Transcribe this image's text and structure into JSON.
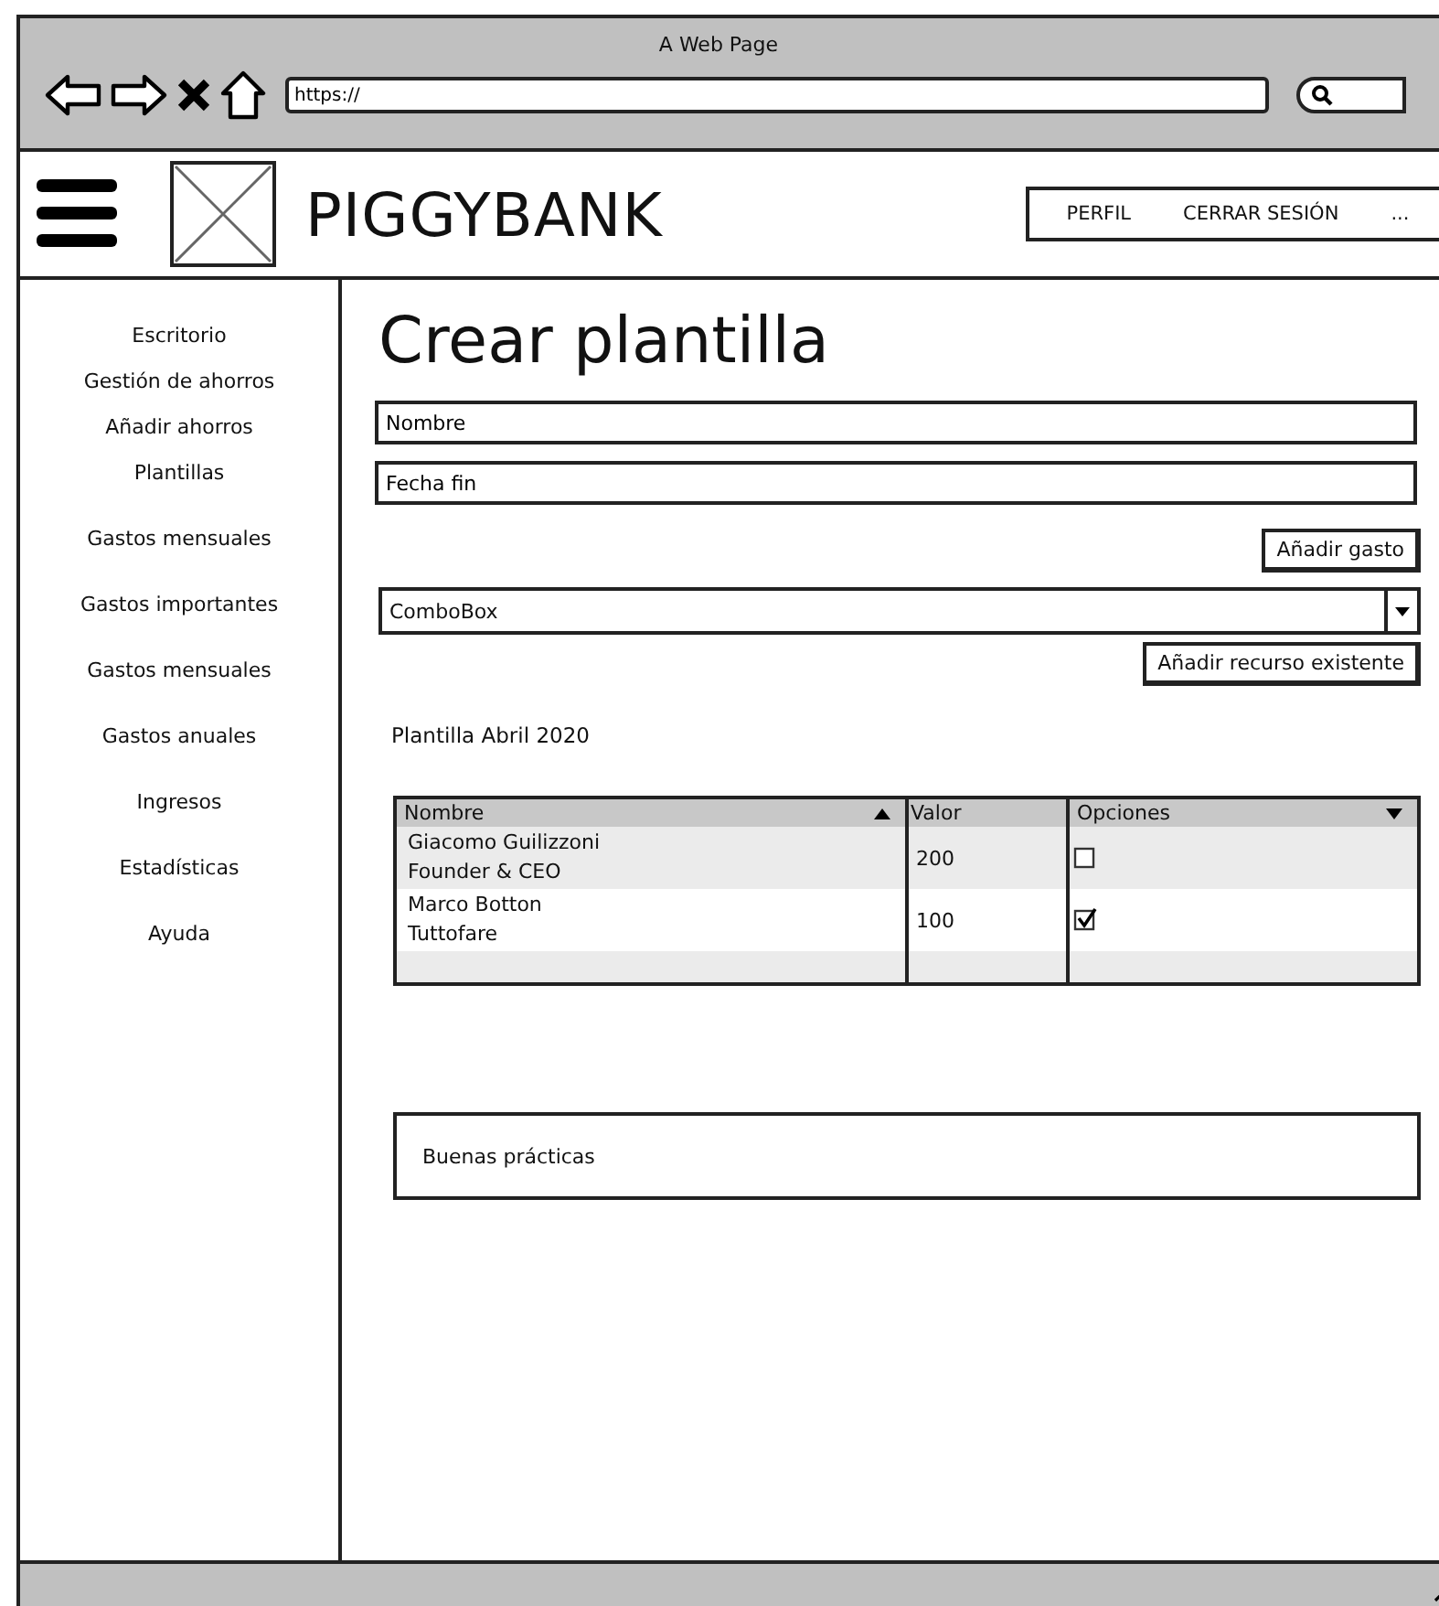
{
  "browser": {
    "title": "A Web Page",
    "url": "https://"
  },
  "header": {
    "logo": "PIGGYBANK",
    "nav": [
      "PERFIL",
      "CERRAR SESIÓN",
      "..."
    ]
  },
  "sidebar": {
    "items": [
      {
        "label": "Escritorio"
      },
      {
        "label": "Gestión de ahorros"
      },
      {
        "label": "Añadir ahorros"
      },
      {
        "label": "Plantillas"
      },
      {
        "label": "Gastos mensuales"
      },
      {
        "label": "Gastos importantes"
      },
      {
        "label": "Gastos mensuales"
      },
      {
        "label": "Gastos anuales"
      },
      {
        "label": "Ingresos"
      },
      {
        "label": "Estadísticas"
      },
      {
        "label": "Ayuda"
      }
    ]
  },
  "main": {
    "title": "Crear plantilla",
    "fields": [
      {
        "value": "Nombre"
      },
      {
        "value": "Fecha fin"
      }
    ],
    "add_expense_button": "Añadir gasto",
    "combo": {
      "value": "ComboBox"
    },
    "add_resource_button": "Añadir recurso existente",
    "template_label": "Plantilla Abril 2020",
    "table": {
      "columns": [
        {
          "label": "Nombre",
          "sorted_ascending": true
        },
        {
          "label": "Valor"
        },
        {
          "label": "Opciones",
          "menu": true
        }
      ],
      "rows": [
        {
          "name": "Giacomo Guilizzoni\nFounder & CEO",
          "value": "200",
          "checked": false
        },
        {
          "name": "Marco Botton\nTuttofare",
          "value": "100",
          "checked": true
        }
      ]
    },
    "tips": "Buenas prácticas"
  }
}
